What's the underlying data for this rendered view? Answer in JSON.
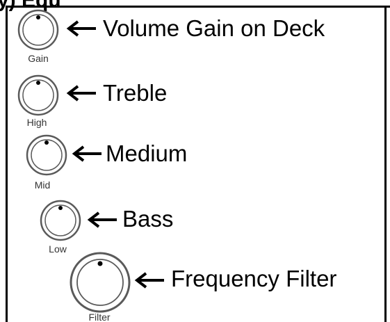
{
  "heading": "y) Equ",
  "controls": [
    {
      "knob_label": "Gain",
      "description": "Volume Gain on Deck"
    },
    {
      "knob_label": "High",
      "description": "Treble"
    },
    {
      "knob_label": "Mid",
      "description": "Medium"
    },
    {
      "knob_label": "Low",
      "description": "Bass"
    },
    {
      "knob_label": "Filter",
      "description": "Frequency Filter"
    }
  ],
  "colors": {
    "knob_outline": "#5a5a5a",
    "knob_fill": "#ffffff",
    "indicator": "#000000",
    "arrow": "#000000"
  }
}
